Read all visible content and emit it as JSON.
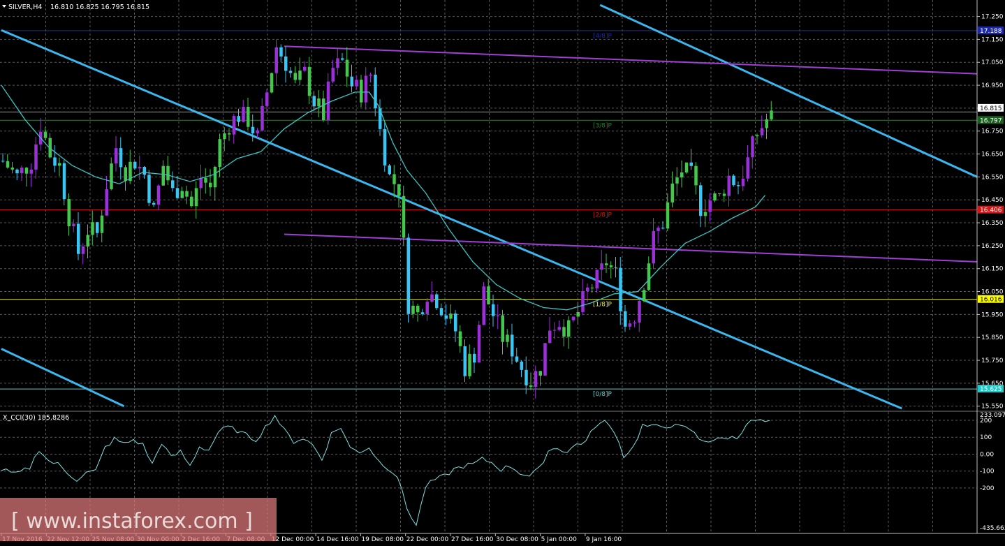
{
  "chart_data": {
    "type": "candlestick",
    "header": {
      "symbol_label": "SILVER,H4",
      "ohlc_text": "16.810 16.825 16.795 16.815"
    },
    "price_ticks": [
      "17.250",
      "17.150",
      "17.050",
      "16.950",
      "16.850",
      "16.750",
      "16.650",
      "16.550",
      "16.450",
      "16.350",
      "16.250",
      "16.150",
      "16.050",
      "15.950",
      "15.850",
      "15.750",
      "15.650",
      "15.550"
    ],
    "price_ylim": [
      15.53,
      17.29
    ],
    "date_labels": [
      "17 Nov 2016",
      "22 Nov 12:00",
      "25 Nov 08:00",
      "30 Nov 00:00",
      "2 Dec 16:00",
      "7 Dec 08:00",
      "12 Dec 00:00",
      "14 Dec 16:00",
      "19 Dec 08:00",
      "22 Dec 00:00",
      "27 Dec 16:00",
      "30 Dec 08:00",
      "5 Jan 00:00",
      "9 Jan 16:00"
    ],
    "bar_count": 125,
    "close_path": [
      [
        0,
        16.62
      ],
      [
        3,
        16.55
      ],
      [
        6,
        16.62
      ],
      [
        8,
        16.78
      ],
      [
        10,
        16.65
      ],
      [
        12,
        16.6
      ],
      [
        14,
        16.38
      ],
      [
        16,
        16.22
      ],
      [
        18,
        16.32
      ],
      [
        20,
        16.3
      ],
      [
        22,
        16.52
      ],
      [
        24,
        16.68
      ],
      [
        26,
        16.58
      ],
      [
        28,
        16.62
      ],
      [
        30,
        16.56
      ],
      [
        32,
        16.4
      ],
      [
        34,
        16.6
      ],
      [
        36,
        16.48
      ],
      [
        38,
        16.52
      ],
      [
        40,
        16.42
      ],
      [
        42,
        16.55
      ],
      [
        44,
        16.5
      ],
      [
        46,
        16.7
      ],
      [
        48,
        16.78
      ],
      [
        50,
        16.82
      ],
      [
        52,
        16.8
      ],
      [
        54,
        16.72
      ],
      [
        56,
        16.92
      ],
      [
        58,
        17.12
      ],
      [
        60,
        17.05
      ],
      [
        62,
        16.95
      ],
      [
        64,
        17.0
      ],
      [
        66,
        16.88
      ],
      [
        68,
        16.82
      ],
      [
        70,
        17.02
      ],
      [
        72,
        17.05
      ],
      [
        74,
        16.95
      ],
      [
        76,
        16.92
      ],
      [
        78,
        17.0
      ],
      [
        80,
        16.75
      ],
      [
        82,
        16.55
      ],
      [
        84,
        16.5
      ],
      [
        86,
        16.0
      ],
      [
        88,
        15.95
      ],
      [
        90,
        16.05
      ],
      [
        92,
        16.02
      ],
      [
        94,
        15.95
      ],
      [
        96,
        15.88
      ],
      [
        98,
        15.72
      ],
      [
        100,
        15.78
      ],
      [
        102,
        16.05
      ],
      [
        104,
        15.95
      ],
      [
        106,
        15.85
      ],
      [
        108,
        15.8
      ],
      [
        110,
        15.72
      ],
      [
        112,
        15.66
      ],
      [
        114,
        15.72
      ],
      [
        116,
        15.9
      ],
      [
        118,
        15.92
      ],
      [
        120,
        15.88
      ],
      [
        122,
        15.96
      ],
      [
        124,
        16.05
      ],
      [
        126,
        16.1
      ],
      [
        128,
        16.18
      ],
      [
        130,
        16.12
      ],
      [
        132,
        15.9
      ],
      [
        134,
        15.95
      ],
      [
        136,
        16.1
      ],
      [
        138,
        16.28
      ],
      [
        140,
        16.35
      ],
      [
        142,
        16.5
      ],
      [
        144,
        16.58
      ],
      [
        146,
        16.55
      ],
      [
        148,
        16.42
      ],
      [
        150,
        16.45
      ],
      [
        152,
        16.46
      ],
      [
        154,
        16.55
      ],
      [
        156,
        16.52
      ],
      [
        158,
        16.62
      ],
      [
        160,
        16.74
      ],
      [
        162,
        16.8
      ],
      [
        163,
        16.81
      ]
    ],
    "ma_path": [
      [
        0,
        16.95
      ],
      [
        5,
        16.8
      ],
      [
        10,
        16.68
      ],
      [
        15,
        16.6
      ],
      [
        20,
        16.55
      ],
      [
        25,
        16.52
      ],
      [
        30,
        16.57
      ],
      [
        35,
        16.56
      ],
      [
        40,
        16.53
      ],
      [
        45,
        16.56
      ],
      [
        50,
        16.63
      ],
      [
        55,
        16.66
      ],
      [
        60,
        16.76
      ],
      [
        65,
        16.83
      ],
      [
        70,
        16.88
      ],
      [
        75,
        16.92
      ],
      [
        78,
        16.92
      ],
      [
        80,
        16.86
      ],
      [
        83,
        16.7
      ],
      [
        86,
        16.58
      ],
      [
        90,
        16.48
      ],
      [
        95,
        16.32
      ],
      [
        100,
        16.18
      ],
      [
        105,
        16.08
      ],
      [
        110,
        16.02
      ],
      [
        115,
        15.98
      ],
      [
        120,
        15.97
      ],
      [
        125,
        16.0
      ],
      [
        130,
        16.04
      ],
      [
        135,
        16.05
      ],
      [
        140,
        16.16
      ],
      [
        145,
        16.26
      ],
      [
        150,
        16.31
      ],
      [
        155,
        16.37
      ],
      [
        160,
        16.42
      ],
      [
        162,
        16.47
      ]
    ],
    "levels": [
      {
        "label": "[4/8]P",
        "price": 17.188,
        "color": "#1e2aa0",
        "tag_color": "#1e2aa0"
      },
      {
        "label": "[3/8]P",
        "price": 16.797,
        "color": "#2e7d32",
        "tag_color": "#1b5e20"
      },
      {
        "label": "[2/8]P",
        "price": 16.406,
        "color": "#d01818",
        "tag_color": "#d01818"
      },
      {
        "label": "[1/8]P",
        "price": 16.016,
        "color": "#e8e850",
        "tag_color": "#ffff00"
      },
      {
        "label": "[0/8]P",
        "price": 15.625,
        "color": "#5fd0d0",
        "tag_color": "#20c8c8"
      }
    ],
    "current_price_tag": "16.815",
    "level_tags": [
      "17.188",
      "16.797",
      "16.406",
      "16.016",
      "15.625"
    ],
    "trendlines": [
      {
        "color": "#3ab7ee",
        "from": [
          0,
          17.19
        ],
        "to": [
          191,
          15.54
        ]
      },
      {
        "color": "#3ab7ee",
        "from": [
          0,
          15.8
        ],
        "to": [
          26,
          15.55
        ]
      },
      {
        "color": "#3ab7ee",
        "from": [
          127,
          17.3
        ],
        "to": [
          207,
          16.55
        ]
      },
      {
        "color": "#9f3fd6",
        "from": [
          60,
          17.12
        ],
        "to": [
          207,
          17.0
        ]
      },
      {
        "color": "#9f3fd6",
        "from": [
          60,
          16.3
        ],
        "to": [
          207,
          16.18
        ]
      }
    ],
    "indicator": {
      "label": "X_CCI(30) 185.8286",
      "ticks": [
        "200",
        "100",
        "0.00",
        "-100",
        "-200",
        "-435.663"
      ],
      "top_value": "233.0977",
      "ylim": [
        -435.663,
        233.0977
      ],
      "path": [
        [
          0,
          -90
        ],
        [
          3,
          -120
        ],
        [
          6,
          -80
        ],
        [
          8,
          30
        ],
        [
          10,
          -40
        ],
        [
          12,
          -60
        ],
        [
          14,
          -110
        ],
        [
          16,
          -150
        ],
        [
          18,
          -110
        ],
        [
          20,
          -100
        ],
        [
          22,
          40
        ],
        [
          24,
          90
        ],
        [
          26,
          60
        ],
        [
          28,
          85
        ],
        [
          30,
          55
        ],
        [
          32,
          -60
        ],
        [
          34,
          70
        ],
        [
          36,
          -20
        ],
        [
          38,
          15
        ],
        [
          40,
          -70
        ],
        [
          42,
          45
        ],
        [
          44,
          25
        ],
        [
          46,
          130
        ],
        [
          48,
          160
        ],
        [
          50,
          140
        ],
        [
          52,
          110
        ],
        [
          54,
          85
        ],
        [
          56,
          160
        ],
        [
          58,
          230
        ],
        [
          60,
          140
        ],
        [
          62,
          75
        ],
        [
          64,
          95
        ],
        [
          66,
          55
        ],
        [
          68,
          -30
        ],
        [
          70,
          120
        ],
        [
          72,
          160
        ],
        [
          74,
          35
        ],
        [
          76,
          15
        ],
        [
          78,
          40
        ],
        [
          80,
          -40
        ],
        [
          82,
          -80
        ],
        [
          84,
          -130
        ],
        [
          86,
          -320
        ],
        [
          88,
          -420
        ],
        [
          90,
          -190
        ],
        [
          92,
          -150
        ],
        [
          94,
          -130
        ],
        [
          96,
          -90
        ],
        [
          98,
          -70
        ],
        [
          100,
          -60
        ],
        [
          102,
          -30
        ],
        [
          104,
          -50
        ],
        [
          106,
          -90
        ],
        [
          108,
          -70
        ],
        [
          110,
          -110
        ],
        [
          112,
          -130
        ],
        [
          114,
          -90
        ],
        [
          116,
          20
        ],
        [
          118,
          40
        ],
        [
          120,
          10
        ],
        [
          122,
          60
        ],
        [
          124,
          75
        ],
        [
          126,
          170
        ],
        [
          128,
          190
        ],
        [
          130,
          140
        ],
        [
          132,
          -10
        ],
        [
          134,
          40
        ],
        [
          136,
          170
        ],
        [
          138,
          160
        ],
        [
          140,
          165
        ],
        [
          142,
          170
        ],
        [
          144,
          160
        ],
        [
          146,
          150
        ],
        [
          148,
          90
        ],
        [
          150,
          80
        ],
        [
          152,
          85
        ],
        [
          154,
          100
        ],
        [
          156,
          95
        ],
        [
          158,
          180
        ],
        [
          160,
          200
        ],
        [
          163,
          186
        ]
      ]
    },
    "watermark": "[ www.instaforex.com ]"
  }
}
